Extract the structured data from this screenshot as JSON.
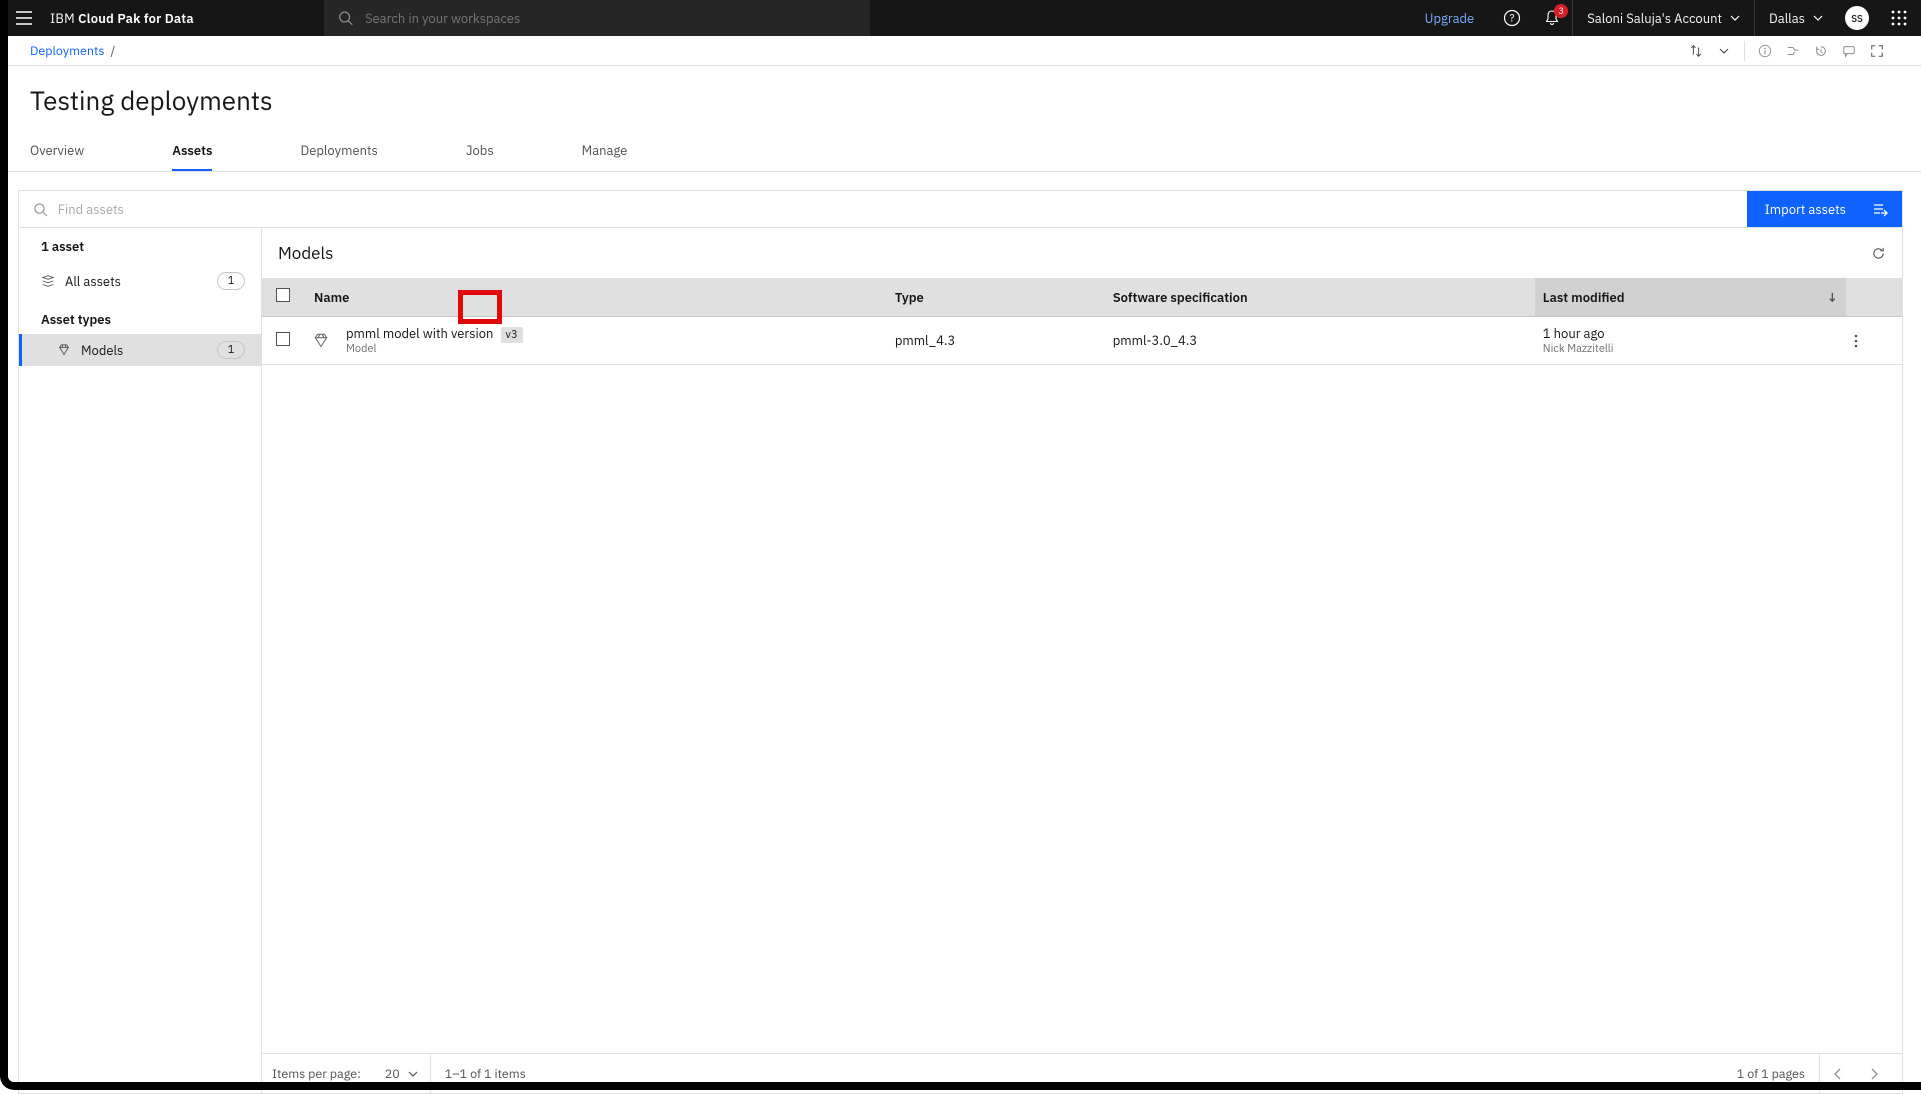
{
  "header": {
    "brand_prefix": "IBM ",
    "brand_bold": "Cloud Pak for Data",
    "search_placeholder": "Search in your workspaces",
    "upgrade": "Upgrade",
    "notification_count": "3",
    "account": "Saloni Saluja's Account",
    "region": "Dallas",
    "avatar_initials": "SS"
  },
  "breadcrumb": {
    "items": [
      "Deployments"
    ],
    "sep": "/"
  },
  "page": {
    "title": "Testing deployments"
  },
  "tabs": {
    "items": [
      "Overview",
      "Assets",
      "Deployments",
      "Jobs",
      "Manage"
    ],
    "active_index": 1
  },
  "toolbar": {
    "find_placeholder": "Find assets",
    "import_label": "Import assets"
  },
  "sidebar": {
    "asset_count_heading": "1 asset",
    "all_assets_label": "All assets",
    "all_assets_count": "1",
    "asset_types_heading": "Asset types",
    "types": [
      {
        "label": "Models",
        "count": "1",
        "active": true
      }
    ]
  },
  "models": {
    "title": "Models",
    "columns": {
      "name": "Name",
      "type": "Type",
      "software_spec": "Software specification",
      "last_modified": "Last modified"
    },
    "rows": [
      {
        "name": "pmml model with version",
        "version": "v3",
        "subtype": "Model",
        "type": "pmml_4.3",
        "software_spec": "pmml-3.0_4.3",
        "modified": "1 hour ago",
        "modified_by": "Nick Mazzitelli"
      }
    ]
  },
  "pagination": {
    "items_per_page_label": "Items per page:",
    "items_per_page_value": "20",
    "range_text": "1–1 of 1 items",
    "page_text": "1 of 1 pages"
  }
}
